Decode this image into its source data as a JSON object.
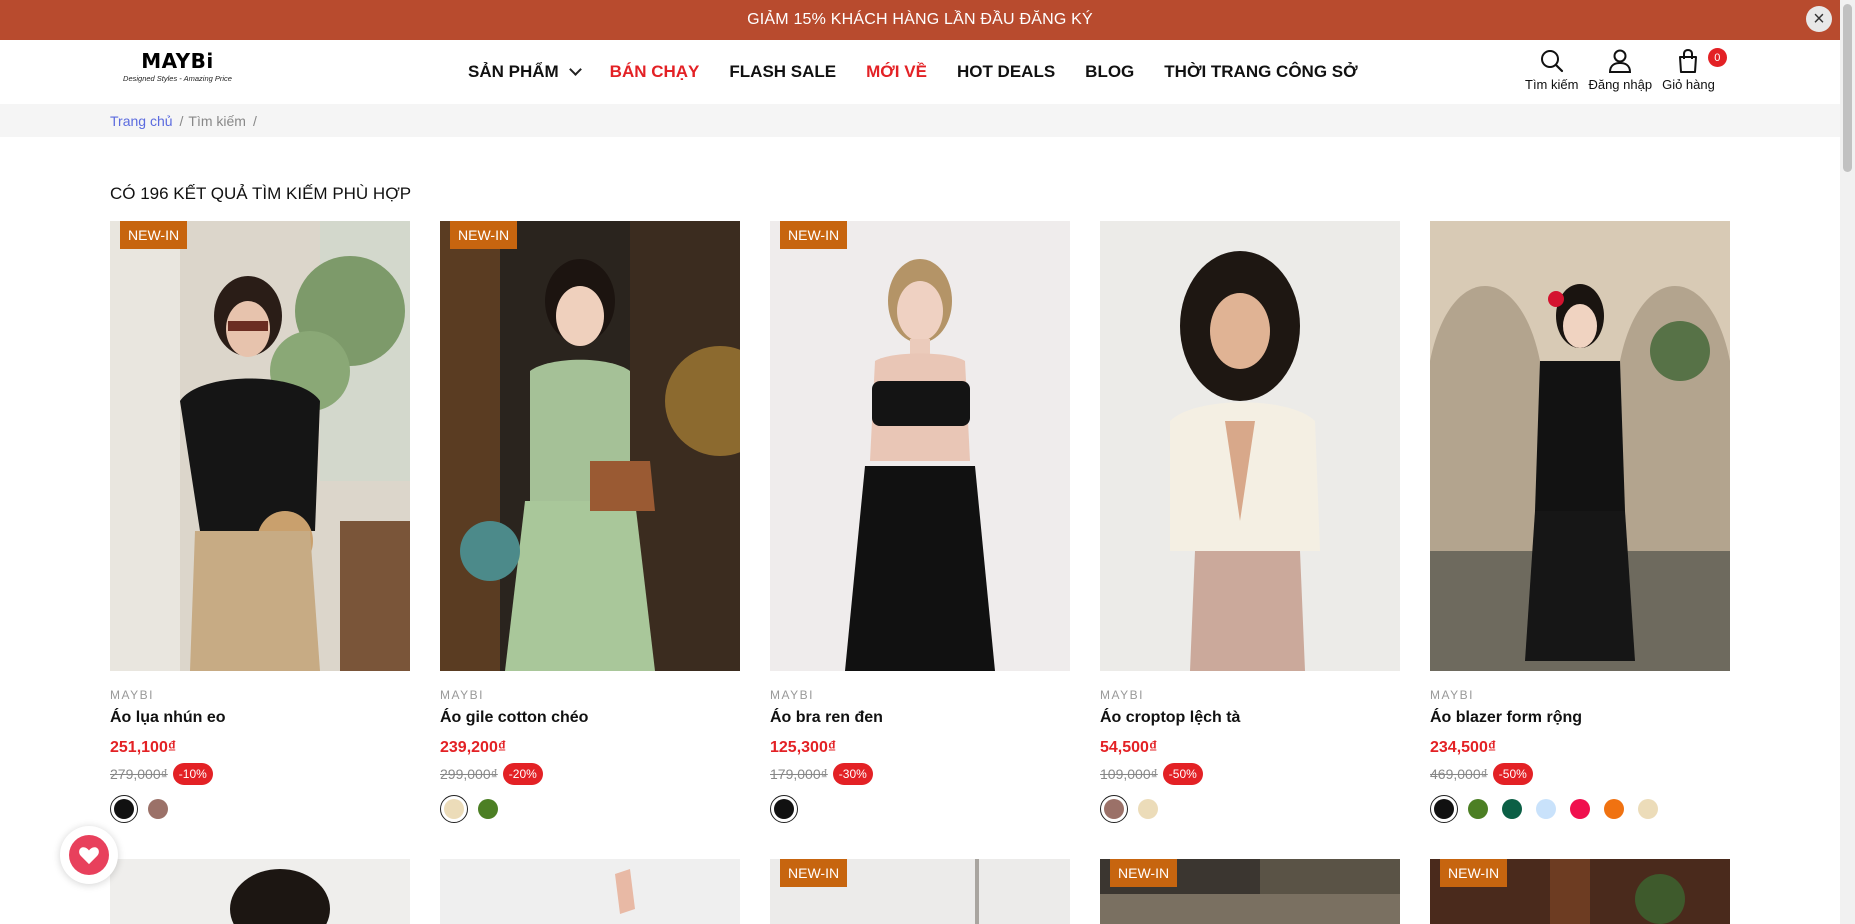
{
  "promo": {
    "text": "GIẢM 15% KHÁCH HÀNG LẦN ĐẦU ĐĂNG KÝ",
    "close_icon": "close-icon"
  },
  "logo": {
    "main": "MAYBi",
    "tagline": "Designed Styles - Amazing Price"
  },
  "nav": [
    {
      "label": "SẢN PHẨM",
      "has_dropdown": true,
      "color": "#111111"
    },
    {
      "label": "BÁN CHẠY",
      "has_dropdown": false,
      "color": "#e32125"
    },
    {
      "label": "FLASH SALE",
      "has_dropdown": false,
      "color": "#111111"
    },
    {
      "label": "MỚI VỀ",
      "has_dropdown": false,
      "color": "#e32125"
    },
    {
      "label": "HOT DEALS",
      "has_dropdown": false,
      "color": "#111111"
    },
    {
      "label": "BLOG",
      "has_dropdown": false,
      "color": "#111111"
    },
    {
      "label": "THỜI TRANG CÔNG SỞ",
      "has_dropdown": false,
      "color": "#111111"
    }
  ],
  "actions": {
    "search": {
      "label": "Tìm kiếm",
      "icon": "search-icon"
    },
    "login": {
      "label": "Đăng nhập",
      "icon": "user-icon"
    },
    "cart": {
      "label": "Giỏ hàng",
      "icon": "cart-icon",
      "count": "0"
    }
  },
  "breadcrumb": {
    "home": "Trang chủ",
    "current": "Tìm kiếm",
    "separator": "/"
  },
  "results_title": "CÓ 196 KẾT QUẢ TÌM KIẾM PHÙ HỢP",
  "colors": {
    "accent_red": "#e32125",
    "promo_bg": "#b84b2e",
    "badge_bg": "#c7650f",
    "link_blue": "#5b6bdf"
  },
  "products": [
    {
      "badge": "NEW-IN",
      "brand": "MAYBI",
      "name": "Áo lụa nhún eo",
      "price": "251,100₫",
      "old_price": "279,000₫",
      "discount": "-10%",
      "swatches": [
        "#111111",
        "#9b7168"
      ]
    },
    {
      "badge": "NEW-IN",
      "brand": "MAYBI",
      "name": "Áo gile cotton chéo",
      "price": "239,200₫",
      "old_price": "299,000₫",
      "discount": "-20%",
      "swatches": [
        "#ecdcb9",
        "#4c7f24"
      ]
    },
    {
      "badge": "NEW-IN",
      "brand": "MAYBI",
      "name": "Áo bra ren đen",
      "price": "125,300₫",
      "old_price": "179,000₫",
      "discount": "-30%",
      "swatches": [
        "#111111"
      ]
    },
    {
      "badge": "",
      "brand": "MAYBI",
      "name": "Áo croptop lệch tà",
      "price": "54,500₫",
      "old_price": "109,000₫",
      "discount": "-50%",
      "swatches": [
        "#9b7168",
        "#ecdcb9"
      ]
    },
    {
      "badge": "",
      "brand": "MAYBI",
      "name": "Áo blazer form rộng",
      "price": "234,500₫",
      "old_price": "469,000₫",
      "discount": "-50%",
      "swatches": [
        "#111111",
        "#4c7f24",
        "#0b5f45",
        "#c9e2fb",
        "#f0104e",
        "#f07211",
        "#ecdcb9"
      ]
    }
  ],
  "second_row_badges": [
    "",
    "",
    "NEW-IN",
    "NEW-IN",
    "NEW-IN"
  ],
  "wishlist": {
    "icon": "heart-icon"
  }
}
